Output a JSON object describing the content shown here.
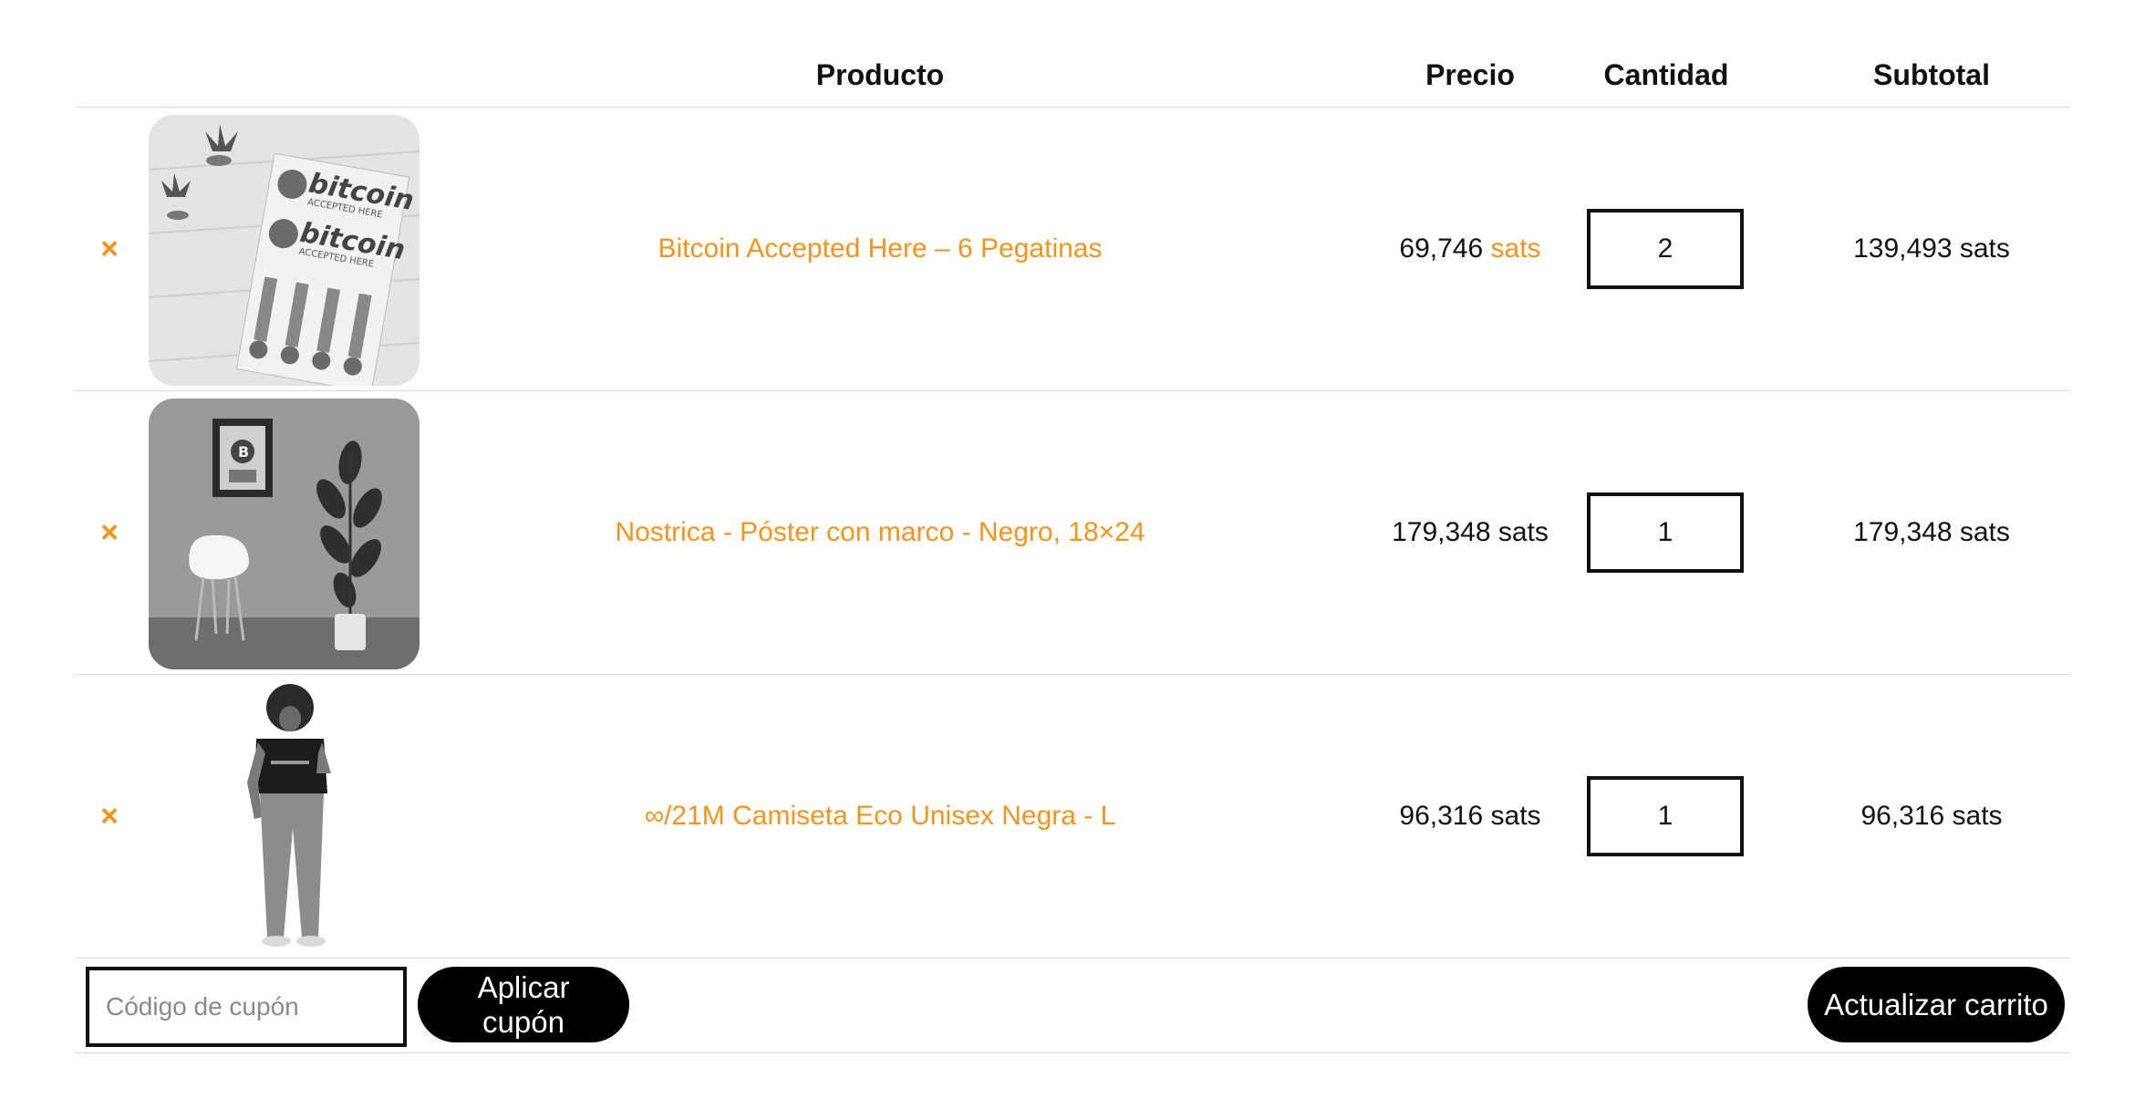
{
  "header": {
    "product": "Producto",
    "price": "Precio",
    "quantity": "Cantidad",
    "subtotal": "Subtotal"
  },
  "items": [
    {
      "remove": "×",
      "name": "Bitcoin Accepted Here – 6 Pegatinas",
      "price_amount": "69,746",
      "price_unit": "sats",
      "quantity": "2",
      "subtotal": "139,493 sats",
      "image_text": "bitcoin",
      "image_subtext": "ACCEPTED HERE"
    },
    {
      "remove": "×",
      "name": "Nostrica - Póster con marco - Negro, 18×24",
      "price_amount": "179,348",
      "price_unit": "sats",
      "quantity": "1",
      "subtotal": "179,348 sats"
    },
    {
      "remove": "×",
      "name": "∞/21M Camiseta Eco Unisex Negra - L",
      "price_amount": "96,316",
      "price_unit": "sats",
      "quantity": "1",
      "subtotal": "96,316 sats"
    }
  ],
  "actions": {
    "coupon_placeholder": "Código de cupón",
    "coupon_value": "",
    "apply_label": "Aplicar cupón",
    "update_label": "Actualizar carrito"
  },
  "colors": {
    "accent": "#f7931a",
    "button_bg": "#000000",
    "divider": "#dcdcdc"
  }
}
